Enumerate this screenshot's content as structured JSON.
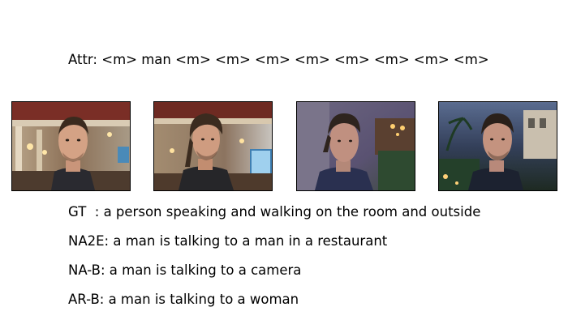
{
  "attr": {
    "label": "Attr:",
    "tokens": "<m> man <m> <m> <m> <m> <m> <m> <m> <m>"
  },
  "frames": [
    {
      "name": "video-frame-1"
    },
    {
      "name": "video-frame-2"
    },
    {
      "name": "video-frame-3"
    },
    {
      "name": "video-frame-4"
    }
  ],
  "captions": {
    "gt": {
      "label": "GT  :",
      "text": "a person speaking and walking on the room and outside"
    },
    "na2e": {
      "label": "NA2E:",
      "text": "a man is talking to a man in a restaurant"
    },
    "nab": {
      "label": "NA-B:",
      "text": "a man is talking to a camera"
    },
    "arb": {
      "label": "AR-B:",
      "text": "a man is talking to a woman"
    }
  }
}
